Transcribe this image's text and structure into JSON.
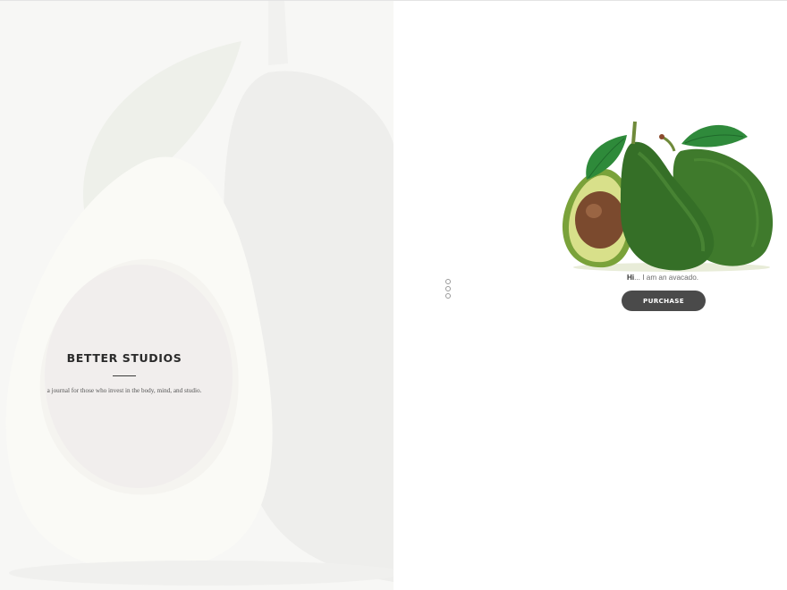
{
  "hero": {
    "title": "BETTER STUDIOS",
    "tagline": "a journal for those who invest in the body, mind, and studio."
  },
  "pager": {
    "slides": 3,
    "icon": "dot-icon"
  },
  "product": {
    "image_icon": "avocado-image",
    "greeting_bold": "Hi",
    "greeting_rest": "... I am an avacado.",
    "purchase_label": "PURCHASE"
  },
  "colors": {
    "hero_bg": "#f7f7f5",
    "button_bg": "#4a4a4a",
    "avocado_skin": "#3f7a2c",
    "avocado_flesh": "#d8e08a",
    "avocado_pit": "#7b4a2e"
  }
}
